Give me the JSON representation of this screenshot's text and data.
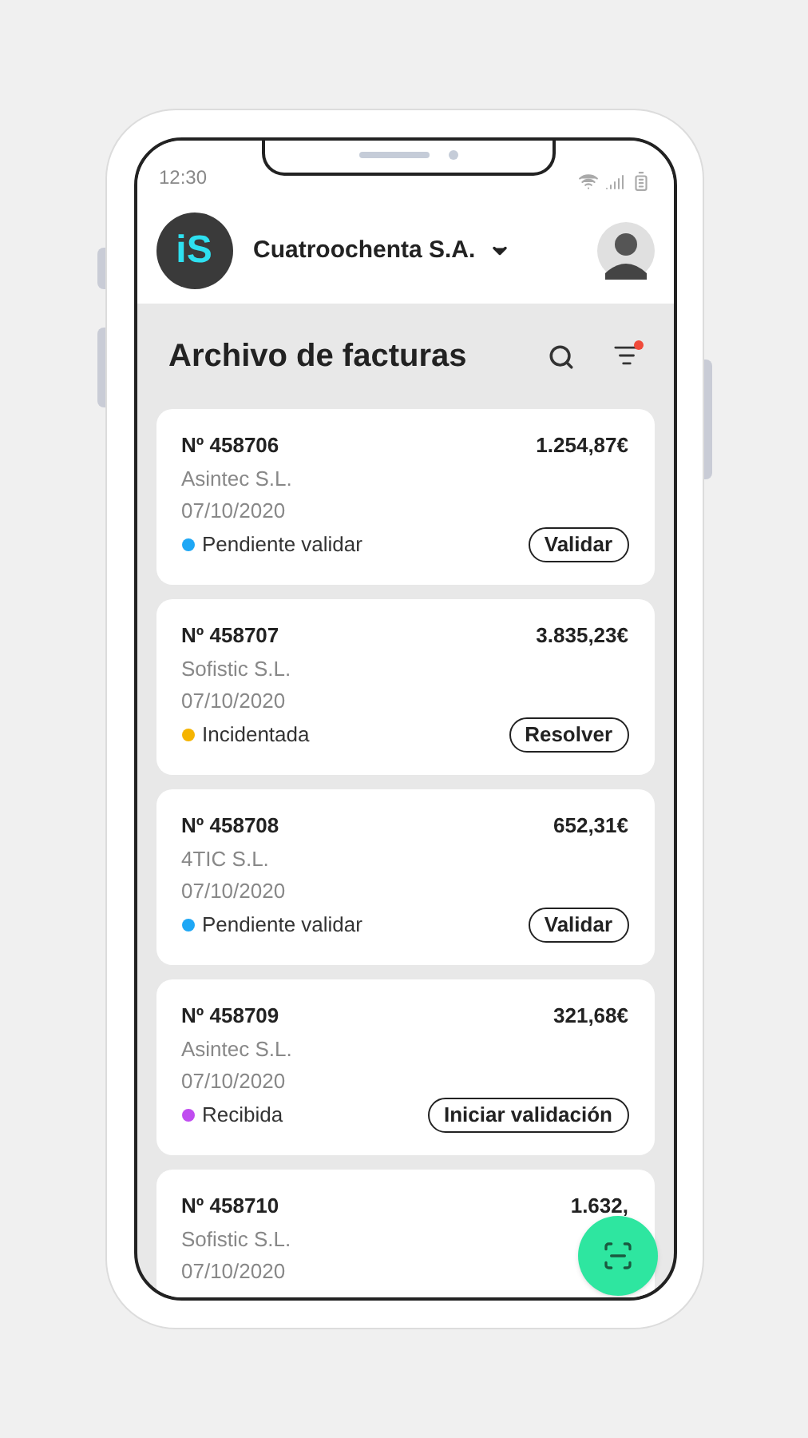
{
  "status_bar": {
    "time": "12:30"
  },
  "header": {
    "logo": "iS",
    "company": "Cuatroochenta S.A."
  },
  "title": "Archivo de facturas",
  "filter": {
    "active": true
  },
  "invoices": [
    {
      "number": "Nº 458706",
      "supplier": "Asintec S.L.",
      "date": "07/10/2020",
      "amount": "1.254,87€",
      "status": "Pendiente validar",
      "color": "#1ea7f5",
      "action": "Validar"
    },
    {
      "number": "Nº 458707",
      "supplier": "Sofistic S.L.",
      "date": "07/10/2020",
      "amount": "3.835,23€",
      "status": "Incidentada",
      "color": "#f5b400",
      "action": "Resolver"
    },
    {
      "number": "Nº 458708",
      "supplier": "4TIC S.L.",
      "date": "07/10/2020",
      "amount": "652,31€",
      "status": "Pendiente validar",
      "color": "#1ea7f5",
      "action": "Validar"
    },
    {
      "number": "Nº 458709",
      "supplier": "Asintec S.L.",
      "date": "07/10/2020",
      "amount": "321,68€",
      "status": "Recibida",
      "color": "#c04cf0",
      "action": "Iniciar validación"
    },
    {
      "number": "Nº 458710",
      "supplier": "Sofistic S.L.",
      "date": "07/10/2020",
      "amount": "1.632,"
    }
  ]
}
